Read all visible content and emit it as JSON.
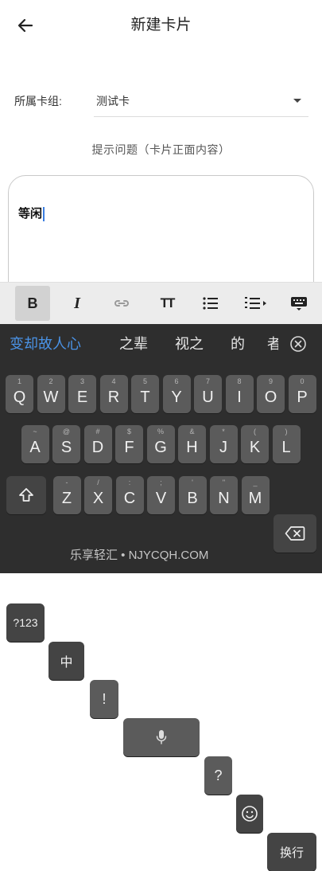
{
  "header": {
    "title": "新建卡片",
    "back_icon": "arrow-left-icon"
  },
  "deck": {
    "label": "所属卡组:",
    "value": "测试卡",
    "caret_icon": "caret-down-icon"
  },
  "prompt_label": "提示问题（卡片正面内容）",
  "editor": {
    "text": "等闲"
  },
  "toolbar": {
    "bold_glyph": "B",
    "italic_glyph": "I",
    "text_size_glyph": "TT",
    "icons": [
      "bold-icon",
      "italic-icon",
      "link-icon",
      "text-size-icon",
      "bullet-list-icon",
      "numbered-list-icon",
      "keyboard-hide-icon"
    ],
    "active": "bold"
  },
  "candidates": [
    "变却故人心",
    "之辈",
    "视之",
    "的",
    "者"
  ],
  "keyboard": {
    "row1": [
      {
        "key": "Q",
        "hint": "1"
      },
      {
        "key": "W",
        "hint": "2"
      },
      {
        "key": "E",
        "hint": "3"
      },
      {
        "key": "R",
        "hint": "4"
      },
      {
        "key": "T",
        "hint": "5"
      },
      {
        "key": "Y",
        "hint": "6"
      },
      {
        "key": "U",
        "hint": "7"
      },
      {
        "key": "I",
        "hint": "8"
      },
      {
        "key": "O",
        "hint": "9"
      },
      {
        "key": "P",
        "hint": "0"
      }
    ],
    "row2": [
      {
        "key": "A",
        "hint": "~"
      },
      {
        "key": "S",
        "hint": "@"
      },
      {
        "key": "D",
        "hint": "#"
      },
      {
        "key": "F",
        "hint": "$"
      },
      {
        "key": "G",
        "hint": "%"
      },
      {
        "key": "H",
        "hint": "&"
      },
      {
        "key": "J",
        "hint": "*"
      },
      {
        "key": "K",
        "hint": "("
      },
      {
        "key": "L",
        "hint": ")"
      }
    ],
    "row3": [
      {
        "key": "Z",
        "hint": "-"
      },
      {
        "key": "X",
        "hint": "/"
      },
      {
        "key": "C",
        "hint": ":"
      },
      {
        "key": "V",
        "hint": ";"
      },
      {
        "key": "B",
        "hint": "'"
      },
      {
        "key": "N",
        "hint": "\""
      },
      {
        "key": "M",
        "hint": "_"
      }
    ],
    "symbols_label": "?123",
    "lang_label": "中",
    "exclaim_label": "!",
    "question_label": "?",
    "enter_label": "换行"
  },
  "watermark": "乐享轻汇 • NJYCQH.COM",
  "colors": {
    "accent": "#4a93e6",
    "keyboard_bg": "#2e2e2e",
    "key_bg": "#5b5b5b",
    "toolbar_bg": "#ececec"
  }
}
